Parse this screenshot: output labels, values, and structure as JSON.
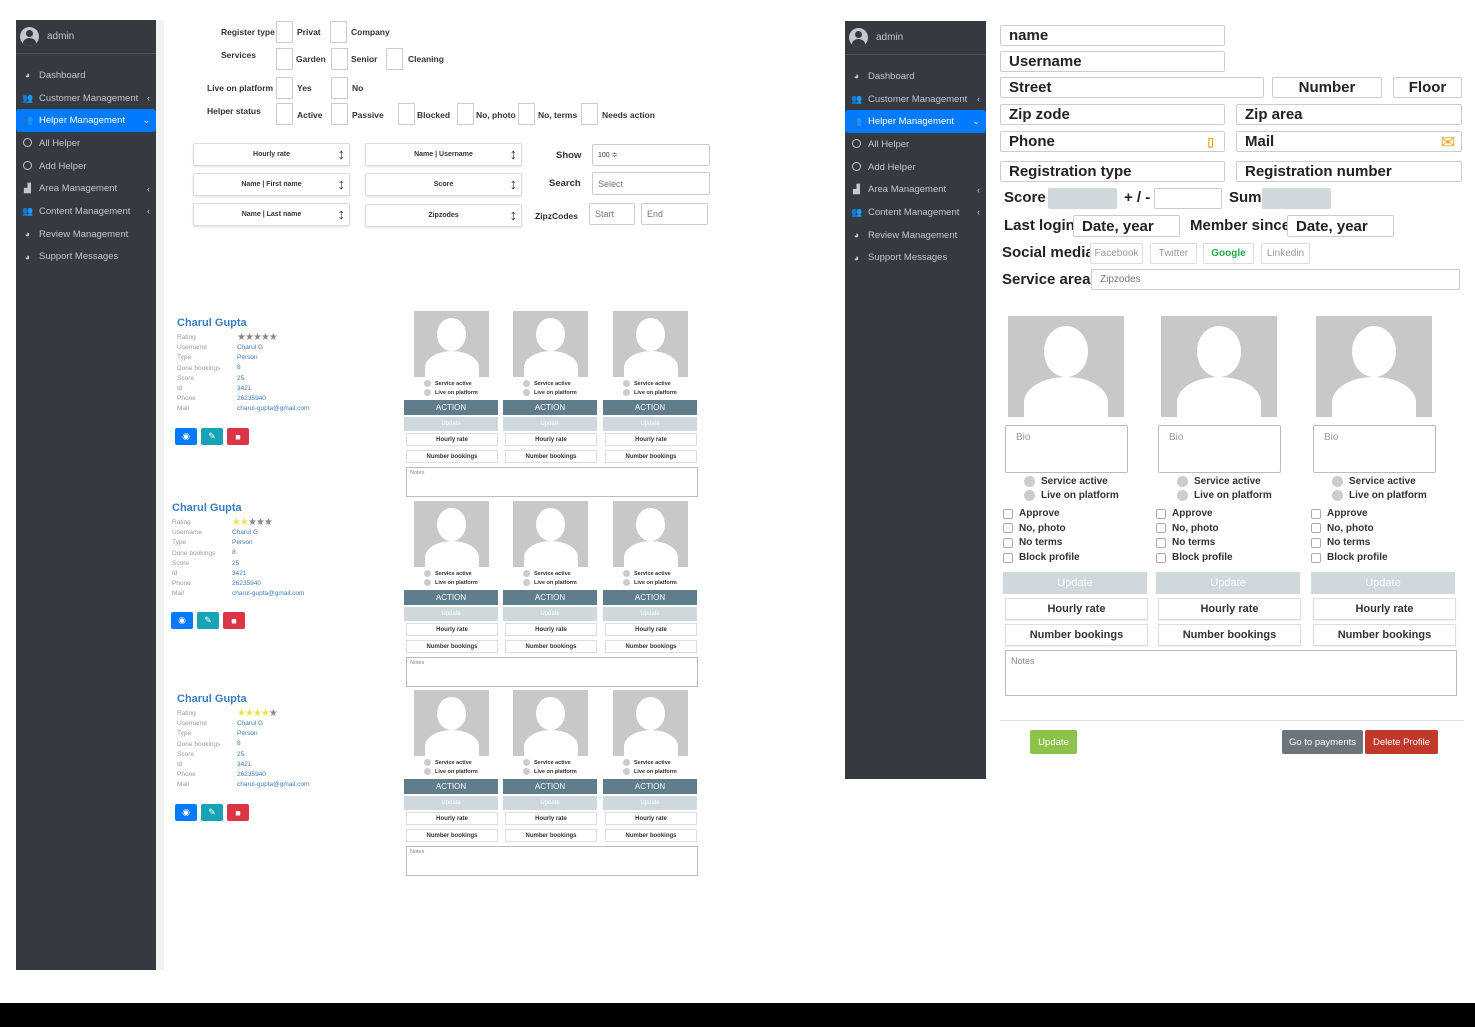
{
  "sidebar": {
    "user": "admin",
    "items": [
      {
        "label": "Dashboard",
        "icon": "tachometer-icon",
        "arrow": ""
      },
      {
        "label": "Customer Management",
        "icon": "users-icon",
        "arrow": "‹"
      },
      {
        "label": "Helper Management",
        "icon": "users-icon",
        "arrow": "⌄",
        "active": true
      },
      {
        "label": "All Helper",
        "icon": "circle-icon",
        "arrow": ""
      },
      {
        "label": "Add Helper",
        "icon": "circle-icon",
        "arrow": ""
      },
      {
        "label": "Area Management",
        "icon": "area-chart-icon",
        "arrow": "‹"
      },
      {
        "label": "Content Management",
        "icon": "users-icon",
        "arrow": "‹"
      },
      {
        "label": "Review Management",
        "icon": "tachometer-icon",
        "arrow": ""
      },
      {
        "label": "Support Messages",
        "icon": "tachometer-icon",
        "arrow": ""
      }
    ]
  },
  "filters": {
    "register_type_label": "Register type",
    "register_opts": [
      "Privat",
      "Company"
    ],
    "services_label": "Services",
    "services_opts": [
      "Garden",
      "Senior",
      "Cleaning"
    ],
    "live_label": "Live on platform",
    "live_opts": [
      "Yes",
      "No"
    ],
    "status_label": "Helper status",
    "status_opts": [
      "Active",
      "Passive",
      "Blocked",
      "No, photo",
      "No, terms",
      "Needs action"
    ],
    "sort_boxes": [
      "Hourly rate",
      "Name | First name",
      "Name | Last name",
      "Name | Username",
      "Score",
      "Zipzodes"
    ],
    "show_label": "Show",
    "show_value": "100 ≑",
    "search_label": "Search",
    "search_placeholder": "Select",
    "zip_label": "ZipzCodes",
    "zip_start": "Start",
    "zip_end": "End"
  },
  "helper_keys": [
    "Rating",
    "Username",
    "Type",
    "Done bookings",
    "Score",
    "Id",
    "Phone",
    "Mail"
  ],
  "helpers": [
    {
      "name": "Charul Gupta",
      "rating": 0,
      "username": "Charul G",
      "type": "Person",
      "bookings": "8",
      "score": "25",
      "id": "3421",
      "phone": "26235940",
      "mail": "charul-gupta@gmail.com"
    },
    {
      "name": "Charul Gupta",
      "rating": 2,
      "username": "Charul G",
      "type": "Person",
      "bookings": "8",
      "score": "25",
      "id": "3421",
      "phone": "26235940",
      "mail": "charul-gupta@gmail.com"
    },
    {
      "name": "Charul Gupta",
      "rating": 4,
      "username": "Charul G",
      "type": "Person",
      "bookings": "8",
      "score": "25",
      "id": "3421",
      "phone": "26235940",
      "mail": "charul-gupta@gmail.com"
    }
  ],
  "card": {
    "service_active": "Service active",
    "live_on_platform": "Live on platform",
    "action": "ACTION",
    "update": "Update",
    "hourly_rate": "Hourly rate",
    "number_bookings": "Number bookings",
    "notes": "Notes"
  },
  "form": {
    "name": "name",
    "username": "Username",
    "street": "Street",
    "number": "Number",
    "floor": "Floor",
    "zip_code": "Zip zode",
    "zip_area": "Zip area",
    "phone": "Phone",
    "mail": "Mail",
    "reg_type": "Registration type",
    "reg_number": "Registration number",
    "score": "Score",
    "plus_minus": "+ / -",
    "sum": "Sum",
    "last_login": "Last login",
    "date_year": "Date, year",
    "member_since": "Member since",
    "social_media": "Social media",
    "socials": [
      "Facebook",
      "Twitter",
      "Google",
      "Linkedin"
    ],
    "service_area": "Service area",
    "zipzodes_placeholder": "Zipzodes",
    "bio": "Bio",
    "service_active": "Service active",
    "live_on_platform": "Live on platform",
    "checks": [
      "Approve",
      "No, photo",
      "No terms",
      "Block profile"
    ],
    "update": "Update",
    "hourly_rate": "Hourly rate",
    "number_bookings": "Number bookings",
    "notes": "Notes",
    "footer_update": "Update",
    "go_payments": "Go to payments",
    "delete_profile": "Delete Profile"
  },
  "colors": {
    "sidebar": "#343a40",
    "active": "#007bff",
    "action": "#607d8b",
    "update_disabled": "#cfd8dc",
    "green": "#8bc34a",
    "red": "#c0392b"
  }
}
